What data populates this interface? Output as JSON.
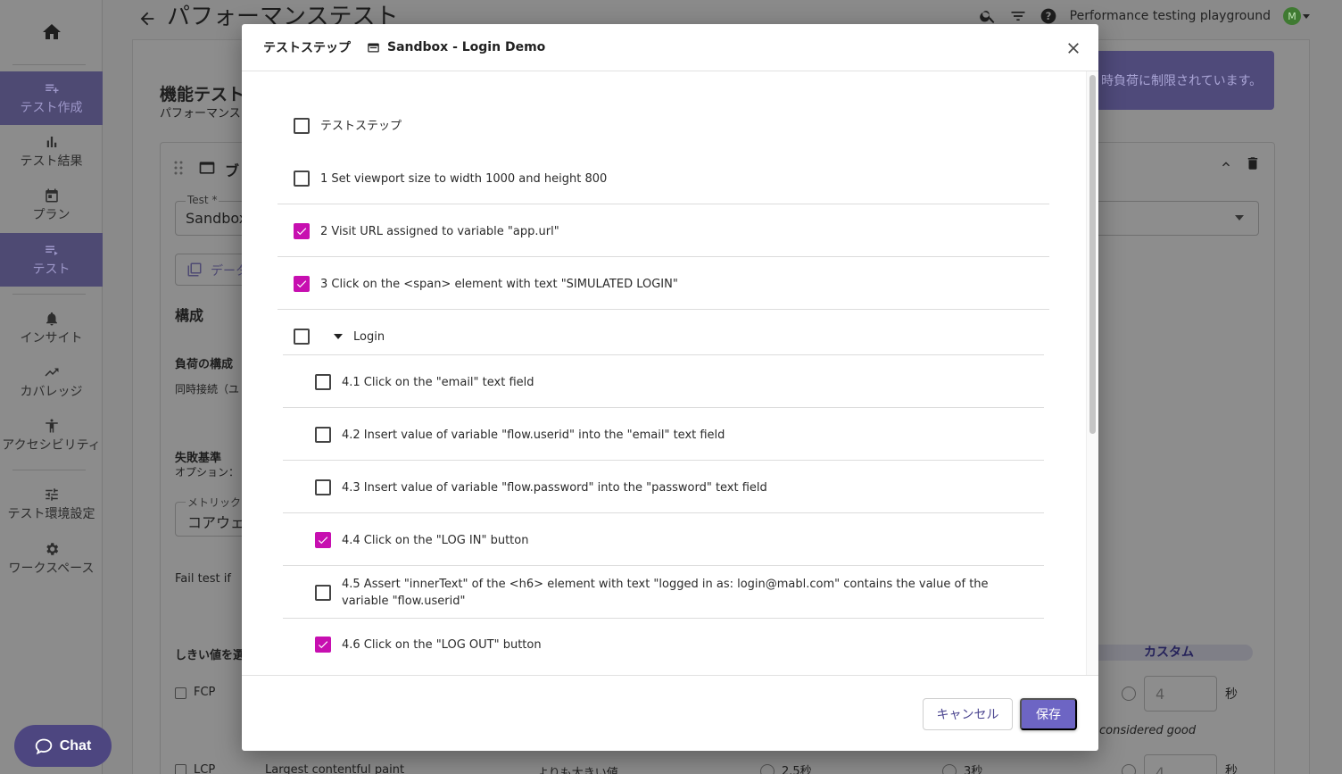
{
  "app": {
    "page_title": "パフォーマンステスト",
    "workspace": "Performance testing playground",
    "avatar_initial": "M"
  },
  "sidebar": {
    "items": [
      {
        "label": "テスト作成",
        "icon": "playlist-add-icon"
      },
      {
        "label": "テスト結果",
        "icon": "bar-chart-icon"
      },
      {
        "label": "プラン",
        "icon": "calendar-icon"
      },
      {
        "label": "テスト",
        "icon": "list-icon"
      },
      {
        "label": "インサイト",
        "icon": "bell-icon"
      },
      {
        "label": "カバレッジ",
        "icon": "trending-up-icon"
      },
      {
        "label": "アクセシビリティ",
        "icon": "accessibility-icon"
      },
      {
        "label": "テスト環境設定",
        "icon": "tune-icon"
      },
      {
        "label": "ワークスペース",
        "icon": "gear-icon"
      }
    ]
  },
  "background": {
    "section_title": "機能テスト",
    "section_sub": "パフォーマンス",
    "notice": "時負荷に制限されています。",
    "test_field_label": "Test *",
    "test_field_value": "Sandbox",
    "data_link": "データ",
    "config_heading": "構成",
    "load_heading": "負荷の構成",
    "load_sub": "同時接続（ユ",
    "fail_heading": "失敗基準",
    "fail_sub": "オプション：",
    "metric_label": "メトリック",
    "metric_value": "コアウェ",
    "fail_if": "Fail test if",
    "threshold_heading": "しきい値を選",
    "fcp": "FCP",
    "lcp": "LCP",
    "lcp_desc": "Largest contentful paint",
    "greater_than": "よりも大きい値",
    "custom_chip": "カスタム",
    "custom_value": "4",
    "seconds": "秒",
    "considered_good": "considered good",
    "t1": "2.5秒",
    "t2": "3秒",
    "card_title": "ブ"
  },
  "chat": {
    "label": "Chat"
  },
  "modal": {
    "title": "テストステップ",
    "test_name": "Sandbox - Login Demo",
    "steps": [
      {
        "label": "テストステップ",
        "checked": false
      },
      {
        "label": "1 Set viewport size to width 1000 and height 800",
        "checked": false
      },
      {
        "label": "2 Visit URL assigned to variable \"app.url\"",
        "checked": true
      },
      {
        "label": "3 Click on the <span> element with text \"SIMULATED LOGIN\"",
        "checked": true
      },
      {
        "label": "Login",
        "checked": false
      },
      {
        "label": "4.1 Click on the \"email\" text field",
        "checked": false
      },
      {
        "label": "4.2 Insert value of variable \"flow.userid\" into the \"email\" text field",
        "checked": false
      },
      {
        "label": "4.3 Insert value of variable \"flow.password\" into the \"password\" text field",
        "checked": false
      },
      {
        "label": "4.4 Click on the \"LOG IN\" button",
        "checked": true
      },
      {
        "label": "4.5 Assert \"innerText\" of the <h6> element with text \"logged in as: login@mabl.com\" contains the value of the variable \"flow.userid\"",
        "checked": false
      },
      {
        "label": "4.6 Click on the \"LOG OUT\" button",
        "checked": true
      }
    ],
    "cancel_label": "キャンセル",
    "save_label": "保存"
  },
  "colors": {
    "checkbox_checked": "#c70fb0",
    "primary": "#6d65c4",
    "sidebar_active": "#4e4a73"
  }
}
